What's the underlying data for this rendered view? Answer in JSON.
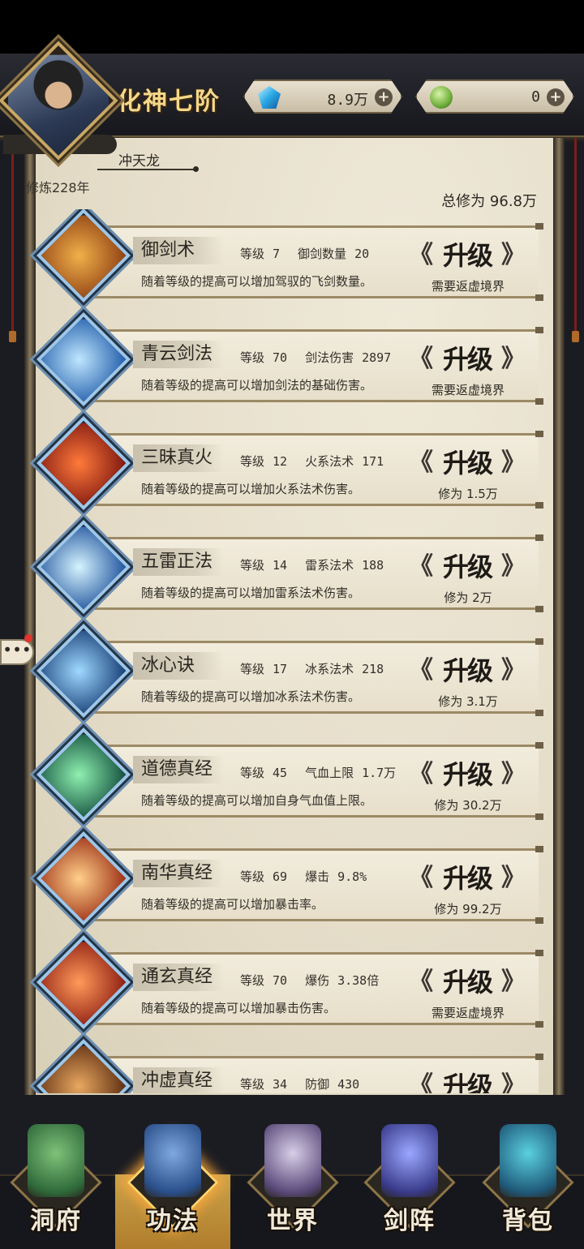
{
  "header": {
    "realm": "化神七阶",
    "currencies": [
      {
        "icon": "blue-crystal-icon",
        "amount": "8.9万"
      },
      {
        "icon": "green-jade-icon",
        "amount": "0"
      }
    ]
  },
  "player": {
    "name": "冲天龙",
    "cultivation_years": "修炼228年",
    "total_cultivation": "总修为 96.8万"
  },
  "skills": [
    {
      "name": "御剑术",
      "level_label": "等级",
      "level": "7",
      "stat_label": "御剑数量",
      "stat_value": "20",
      "desc": "随着等级的提高可以增加驾驭的飞剑数量。",
      "button": "升级",
      "requirement": "需要返虚境界",
      "colors": [
        "#f2b04a",
        "#8b3e12"
      ]
    },
    {
      "name": "青云剑法",
      "level_label": "等级",
      "level": "70",
      "stat_label": "剑法伤害",
      "stat_value": "2897",
      "desc": "随着等级的提高可以增加剑法的基础伤害。",
      "button": "升级",
      "requirement": "需要返虚境界",
      "colors": [
        "#bfe6ff",
        "#1e5aa8"
      ]
    },
    {
      "name": "三昧真火",
      "level_label": "等级",
      "level": "12",
      "stat_label": "火系法术",
      "stat_value": "171",
      "desc": "随着等级的提高可以增加火系法术伤害。",
      "button": "升级",
      "requirement": "修为 1.5万",
      "colors": [
        "#ff7a3a",
        "#7a1410"
      ]
    },
    {
      "name": "五雷正法",
      "level_label": "等级",
      "level": "14",
      "stat_label": "雷系法术",
      "stat_value": "188",
      "desc": "随着等级的提高可以增加雷系法术伤害。",
      "button": "升级",
      "requirement": "修为 2万",
      "colors": [
        "#d6f4ff",
        "#1b4f9a"
      ]
    },
    {
      "name": "冰心诀",
      "level_label": "等级",
      "level": "17",
      "stat_label": "冰系法术",
      "stat_value": "218",
      "desc": "随着等级的提高可以增加冰系法术伤害。",
      "button": "升级",
      "requirement": "修为 3.1万",
      "colors": [
        "#9fd8ff",
        "#133a72"
      ]
    },
    {
      "name": "道德真经",
      "level_label": "等级",
      "level": "45",
      "stat_label": "气血上限",
      "stat_value": "1.7万",
      "desc": "随着等级的提高可以增加自身气血值上限。",
      "button": "升级",
      "requirement": "修为 30.2万",
      "colors": [
        "#8ff0b0",
        "#0f4a3a"
      ]
    },
    {
      "name": "南华真经",
      "level_label": "等级",
      "level": "69",
      "stat_label": "爆击",
      "stat_value": "9.8%",
      "desc": "随着等级的提高可以增加暴击率。",
      "button": "升级",
      "requirement": "修为 99.2万",
      "colors": [
        "#ffd08a",
        "#9a2a12"
      ]
    },
    {
      "name": "通玄真经",
      "level_label": "等级",
      "level": "70",
      "stat_label": "爆伤",
      "stat_value": "3.38倍",
      "desc": "随着等级的提高可以增加暴击伤害。",
      "button": "升级",
      "requirement": "需要返虚境界",
      "colors": [
        "#ff9a5a",
        "#8a1a10"
      ]
    },
    {
      "name": "冲虚真经",
      "level_label": "等级",
      "level": "34",
      "stat_label": "防御",
      "stat_value": "430",
      "desc": "",
      "button": "升级",
      "requirement": "",
      "colors": [
        "#e8a860",
        "#5a2a10"
      ]
    }
  ],
  "chat": {
    "label": "•••"
  },
  "nav": [
    {
      "label": "洞府",
      "icon": "cave-dwelling-icon",
      "active": false,
      "colors": [
        "#7fc27a",
        "#2f6a3a"
      ]
    },
    {
      "label": "功法",
      "icon": "technique-book-icon",
      "active": true,
      "colors": [
        "#7fa8e0",
        "#2a4f8a"
      ]
    },
    {
      "label": "世界",
      "icon": "world-scroll-icon",
      "active": false,
      "colors": [
        "#d8cfe8",
        "#5a4a7a"
      ]
    },
    {
      "label": "剑阵",
      "icon": "sword-array-icon",
      "active": false,
      "colors": [
        "#9aa8ff",
        "#3a3a8a"
      ]
    },
    {
      "label": "背包",
      "icon": "backpack-icon",
      "active": false,
      "colors": [
        "#5ad0e0",
        "#1f5a7a"
      ]
    }
  ]
}
